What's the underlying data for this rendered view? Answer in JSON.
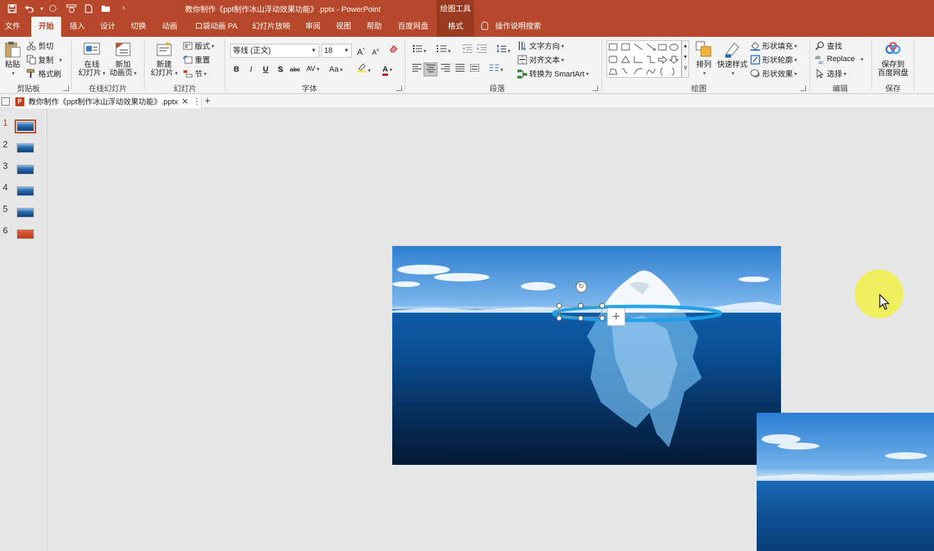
{
  "titlebar": {
    "doc_title": "教你制作《ppt制作冰山浮动效果功能》.pptx  -  PowerPoint",
    "context_group": "绘图工具",
    "quick_access": [
      "save-icon",
      "undo-icon",
      "redo-icon",
      "touch-mode-icon",
      "new-icon",
      "open-icon",
      "customize-icon"
    ]
  },
  "tabs": {
    "file": "文件",
    "home": "开始",
    "insert": "插入",
    "design": "设计",
    "transitions": "切换",
    "animations": "动画",
    "pocket": "口袋动画 PA",
    "slideshow": "幻灯片放映",
    "review": "审阅",
    "view": "视图",
    "help": "帮助",
    "baidu": "百度网盘",
    "format": "格式",
    "tell_me": "操作说明搜索"
  },
  "ribbon": {
    "clipboard": {
      "label": "剪贴板",
      "paste": "粘贴",
      "cut": "剪切",
      "copy": "复制",
      "painter": "格式刷"
    },
    "online": {
      "label": "在线幻灯片",
      "btn1_l1": "在线",
      "btn1_l2": "幻灯片",
      "btn2_l1": "新加",
      "btn2_l2": "动画页"
    },
    "slides": {
      "label": "幻灯片",
      "new_l1": "新建",
      "new_l2": "幻灯片",
      "layout": "版式",
      "reset": "重置",
      "section": "节"
    },
    "font": {
      "label": "字体",
      "name": "等线 (正文)",
      "size": "18",
      "bold": "B",
      "italic": "I",
      "underline": "U",
      "shadow": "S",
      "strike": "abc",
      "spacing": "AV",
      "case": "Aa",
      "grow": "A",
      "shrink": "A",
      "color": "A"
    },
    "paragraph": {
      "label": "段落",
      "text_dir": "文字方向",
      "align_text": "对齐文本",
      "smartart": "转换为 SmartArt"
    },
    "drawing": {
      "label": "绘图",
      "arrange": "排列",
      "quick_styles": "快速样式",
      "fill": "形状填充",
      "outline": "形状轮廓",
      "effects": "形状效果"
    },
    "editing": {
      "label": "编辑",
      "find": "查找",
      "replace": "Replace",
      "select": "选择"
    },
    "save": {
      "label": "保存",
      "l1": "保存到",
      "l2": "百度网盘"
    }
  },
  "doc_tab": {
    "name": "教你制作《ppt制作冰山浮动效果功能》.pptx"
  },
  "thumbnails": [
    {
      "num": "1",
      "selected": true
    },
    {
      "num": "2",
      "selected": false
    },
    {
      "num": "3",
      "selected": false
    },
    {
      "num": "4",
      "selected": false
    },
    {
      "num": "5",
      "selected": false
    },
    {
      "num": "6",
      "selected": false
    }
  ],
  "colors": {
    "accent": "#b7472a",
    "ribbon_bg": "#f3f3f3",
    "canvas_bg": "#e6e6e6",
    "ring": "#1aa0e8"
  }
}
